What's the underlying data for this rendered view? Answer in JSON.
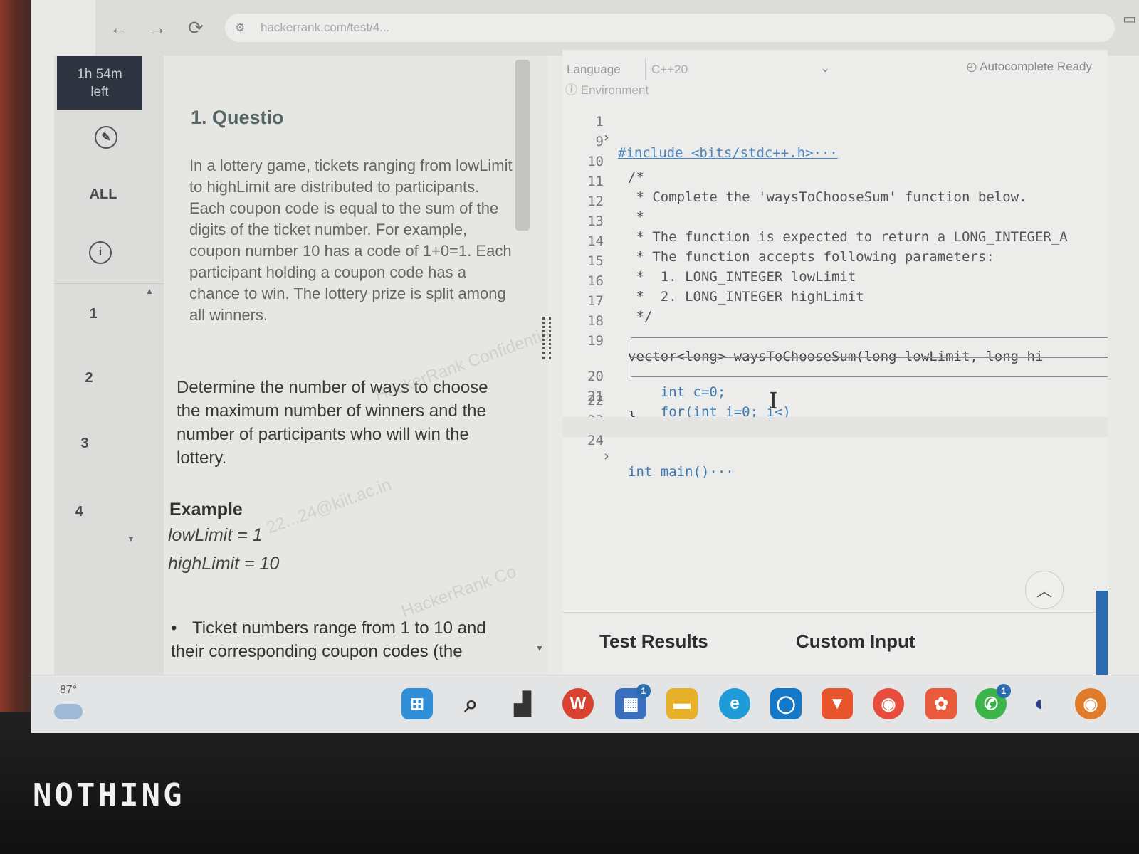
{
  "browser": {
    "url": "hackerrank.com/test/4...",
    "back_icon": "←",
    "forward_icon": "→",
    "reload_icon": "⟳"
  },
  "rail": {
    "timer_line1": "1h 54m",
    "timer_line2": "left",
    "all_label": "ALL",
    "questions": [
      "1",
      "2",
      "3",
      "4"
    ]
  },
  "problem": {
    "title": "1. Questio",
    "para1": "In a lottery game, tickets ranging from lowLimit to highLimit are distributed to participants. Each coupon code is equal to the sum of the digits of the ticket number. For example, coupon number 10 has a code of 1+0=1. Each participant holding a coupon code has a chance to win. The lottery prize is split among all winners.",
    "para2": "Determine the number of ways to choose the maximum number of winners and the number of participants who will win the lottery.",
    "example_title": "Example",
    "example_low": "lowLimit = 1",
    "example_high": "highLimit = 10",
    "bullet": "Ticket numbers range from 1 to 10 and their corresponding coupon codes (the",
    "watermark1": "HackerRank Confidential",
    "watermark2": "22...24@kiit.ac.in",
    "watermark3": "HackerRank Co"
  },
  "editor": {
    "language_label": "Language",
    "language_value": "C++20",
    "autocomplete": "Autocomplete Ready",
    "environment": "Environment",
    "lines": [
      {
        "n": "1",
        "t": "#include <bits/stdc++.h>···"
      },
      {
        "n": "9",
        "t": ""
      },
      {
        "n": "10",
        "t": "/*"
      },
      {
        "n": "11",
        "t": " * Complete the 'waysToChooseSum' function below."
      },
      {
        "n": "12",
        "t": " *"
      },
      {
        "n": "13",
        "t": " * The function is expected to return a LONG_INTEGER_A"
      },
      {
        "n": "14",
        "t": " * The function accepts following parameters:"
      },
      {
        "n": "15",
        "t": " *  1. LONG_INTEGER lowLimit"
      },
      {
        "n": "16",
        "t": " *  2. LONG_INTEGER highLimit"
      },
      {
        "n": "17",
        "t": " */"
      },
      {
        "n": "18",
        "t": ""
      },
      {
        "n": "19",
        "t": "vector<long> waysToChooseSum(long lowLimit, long hi"
      },
      {
        "n": "20",
        "t": "    int c=0;"
      },
      {
        "n": "21",
        "t": "    for(int i=0; i<)"
      },
      {
        "n": "22",
        "t": "}"
      },
      {
        "n": "23",
        "t": ""
      },
      {
        "n": "24",
        "t": "int main()···"
      }
    ],
    "tab_results": "Test Results",
    "tab_custom": "Custom Input"
  },
  "taskbar": {
    "temperature": "87°",
    "badge_store": "1",
    "badge_whatsapp": "1"
  },
  "device_logo": "NOTHING"
}
